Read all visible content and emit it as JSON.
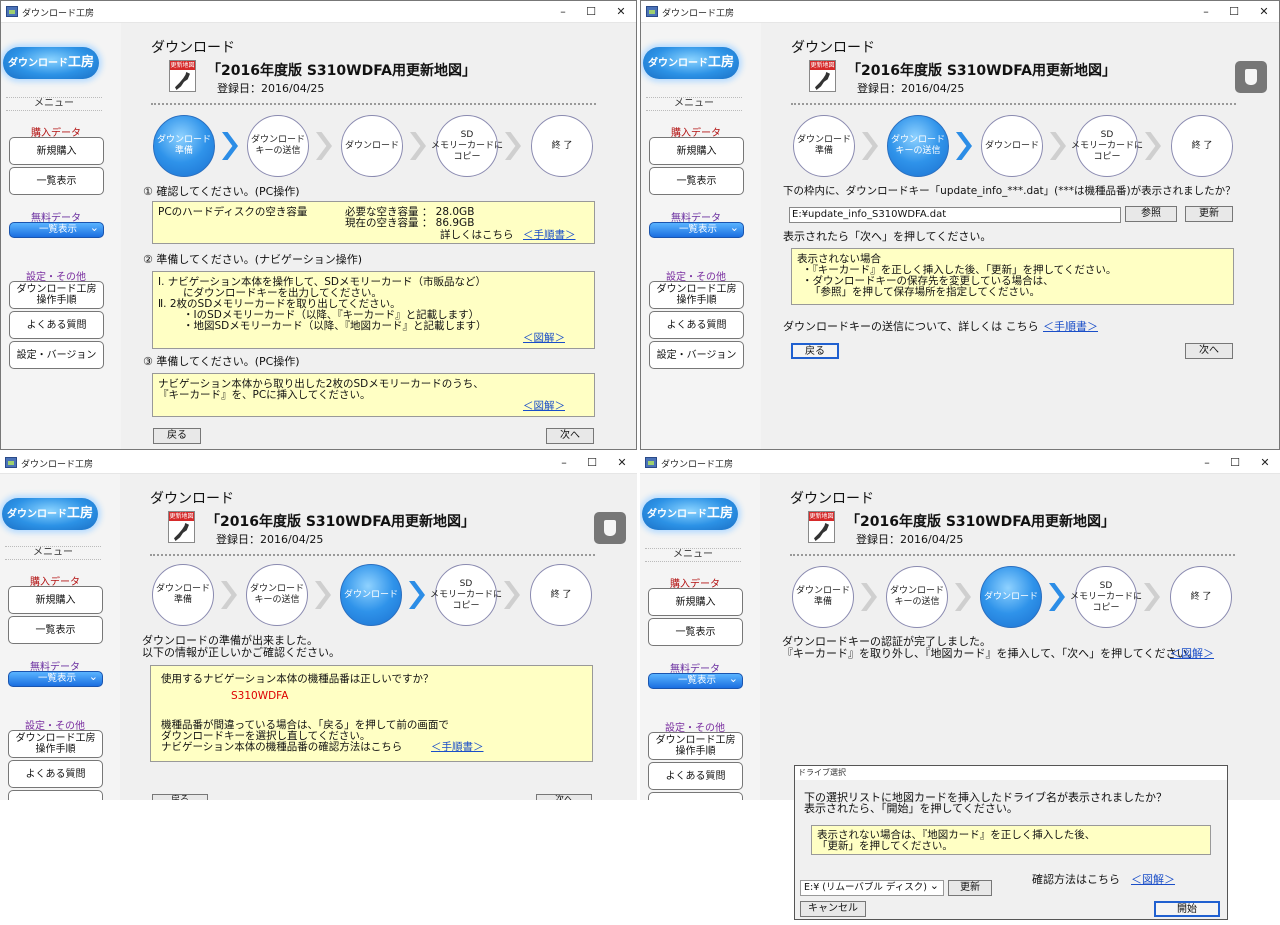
{
  "app": {
    "title": "ダウンロード工房",
    "controls": {
      "minimize": "–",
      "maximize": "☐",
      "close": "✕"
    }
  },
  "sidebar": {
    "logo_prefix": "ダウンロード",
    "logo_main": "工房",
    "menu_label": "メニュー",
    "buy_label": "購入データ",
    "new_purchase": "新規購入",
    "list_view": "一覧表示",
    "free_label": "無料データ",
    "free_list": "一覧表示",
    "settings_label": "設定・その他",
    "manual": "ダウンロード工房\n操作手順",
    "faq": "よくある質問",
    "version": "設定・バージョン"
  },
  "header": {
    "heading": "ダウンロード",
    "map_icon_label": "更新地図",
    "product": "「2016年度版 S310WDFA用更新地図」",
    "registered": "登録日：2016/04/25"
  },
  "steps": [
    {
      "label": "ダウンロード\n準備"
    },
    {
      "label": "ダウンロード\nキーの送信"
    },
    {
      "label": "ダウンロード"
    },
    {
      "label": "SD\nメモリーカードに\nコピー"
    },
    {
      "label": "終 了"
    }
  ],
  "common": {
    "back": "戻る",
    "next": "次へ",
    "procedure_link": "＜手順書＞",
    "figure_link": "＜図解＞"
  },
  "window1": {
    "section1_title": "① 確認してください。(PC操作)",
    "disk_label": "PCのハードディスクの空き容量",
    "need_line": "必要な空き容量 ：  28.0GB",
    "current_line": "現在の空き容量 ：  86.9GB",
    "detail": "詳しくはこちら",
    "section2_title": "② 準備してください。(ナビゲーション操作)",
    "s2_l1": "Ⅰ. ナビゲーション本体を操作して、SDメモリーカード（市販品など）",
    "s2_l2": "にダウンロードキーを出力してください。",
    "s2_l3": "Ⅱ. 2枚のSDメモリーカードを取り出してください。",
    "s2_l4": "・ⅠのSDメモリーカード（以降、『キーカード』と記載します）",
    "s2_l5": "・地図SDメモリーカード（以降、『地図カード』と記載します）",
    "section3_title": "③ 準備してください。(PC操作)",
    "s3_l1": "ナビゲーション本体から取り出した2枚のSDメモリーカードのうち、",
    "s3_l2": "『キーカード』を、PCに挿入してください。"
  },
  "window2": {
    "question": "下の枠内に、ダウンロードキー「update_info_***.dat」(***は機種品番)が表示されましたか？",
    "path_value": "E:¥update_info_S310WDFA.dat",
    "browse": "参照",
    "refresh": "更新",
    "instruction": "表示されたら「次へ」を押してください。",
    "nd_l1": "表示されない場合",
    "nd_l2": "・『キーカード』を正しく挿入した後、「更新」を押してください。",
    "nd_l3": "・ダウンロードキーの保存先を変更している場合は、",
    "nd_l4": "「参照」を押して保存場所を指定してください。",
    "detail": "ダウンロードキーの送信について、詳しくは こちら"
  },
  "window3": {
    "ready_l1": "ダウンロードの準備が出来ました。",
    "ready_l2": "以下の情報が正しいかご確認ください。",
    "q": "使用するナビゲーション本体の機種品番は正しいですか？",
    "model": "S310WDFA",
    "w_l1": "機種品番が間違っている場合は、「戻る」を押して前の画面で",
    "w_l2": "ダウンロードキーを選択し直してください。",
    "w_l3": "ナビゲーション本体の機種品番の確認方法はこちら"
  },
  "window4": {
    "auth_l1": "ダウンロードキーの認証が完了しました。",
    "auth_l2": "『キーカード』を取り外し、『地図カード』を挿入して、「次へ」を押してください。"
  },
  "dialog": {
    "title": "ドライブ選択",
    "q_l1": "下の選択リストに地図カードを挿入したドライブ名が表示されましたか？",
    "q_l2": "表示されたら、「開始」を押してください。",
    "nd_l1": "表示されない場合は、『地図カード』を正しく挿入した後、",
    "nd_l2": "「更新」を押してください。",
    "confirm": "確認方法はこちら",
    "drive": "E:¥ (リムーバブル ディスク)",
    "refresh": "更新",
    "cancel": "キャンセル",
    "start": "開始"
  }
}
